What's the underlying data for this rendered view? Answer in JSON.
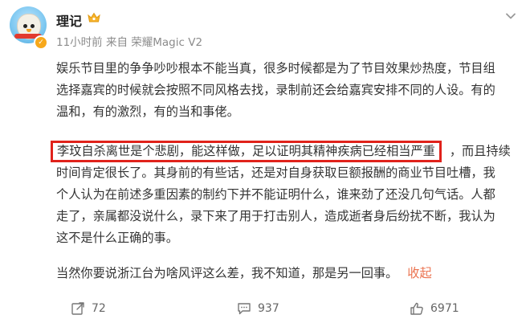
{
  "post": {
    "author": "理记",
    "meta": "11小时前 来自 荣耀Magic V2",
    "paragraph1_lines": [
      "娱乐节目里的争争吵吵根本不能当真，很多时候都是为了节目效果炒热度，节目组",
      "选择嘉宾的时候就会按照不同风格去找，录制前还会给嘉宾安排不同的人设。有的",
      "温和，有的激烈，有的当和事佬。"
    ],
    "highlighted_text": "李玟自杀离世是个悲剧，能这样做，足以证明其精神疾病已经相当严重",
    "after_highlight": "，而且持续",
    "paragraph2_lines": [
      "时间肯定很长了。其身前的有些话，还是对自身获取巨额报酬的商业节目吐槽，我",
      "个人认为在前述多重因素的制约下并不能证明什么，谁来劲了还没几句气话。人都",
      "走了，亲属都没说什么，录下来了用于打击别人，造成逝者身后纷扰不断，我认为",
      "这不是什么正确的事。"
    ],
    "paragraph3": "当然你要说浙江台为啥风评这么差，我不知道，那是另一回事。",
    "collapse_label": "收起"
  },
  "actions": {
    "repost_count": "72",
    "comment_count": "937",
    "like_count": "6971"
  },
  "icons": {
    "menu": "chevron-down-icon",
    "repost": "repost-icon",
    "comment": "comment-icon",
    "like": "like-icon",
    "crown": "crown-icon"
  },
  "colors": {
    "highlight_border": "#e0221b",
    "collapse_link": "#eb7350",
    "meta_text": "#8c8c8c"
  }
}
